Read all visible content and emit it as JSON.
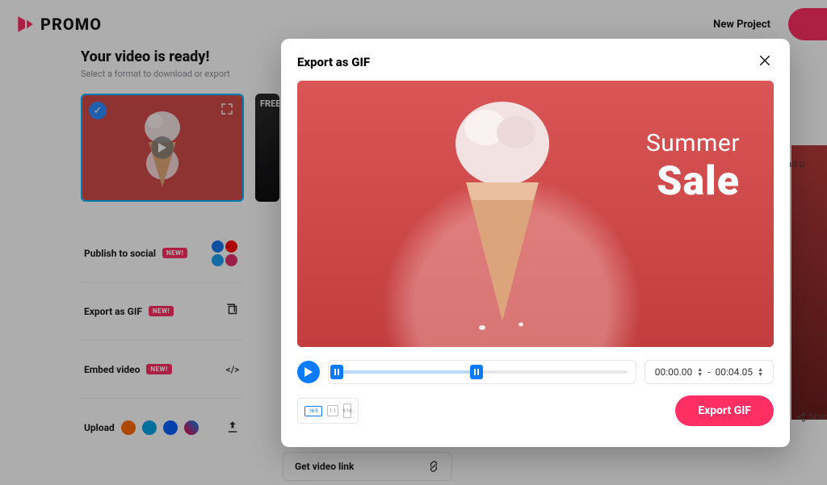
{
  "brand": "PROMO",
  "header": {
    "new_project": "New Project"
  },
  "page": {
    "title": "Your video is ready!",
    "subtitle": "Select a format to download or export",
    "free_badge": "FREE"
  },
  "options": {
    "publish": "Publish to social",
    "export_gif": "Export as GIF",
    "embed": "Embed video",
    "upload": "Upload",
    "new_badge": "NEW!",
    "embed_code": "</>",
    "get_link": "Get video link"
  },
  "right": {
    "text": "t and p",
    "share": "Shar"
  },
  "modal": {
    "title": "Export as GIF",
    "preview_line1": "Summer",
    "preview_line2": "Sale",
    "time_start": "00:00.00",
    "time_sep": "-",
    "time_end": "00:04.05",
    "ratios": {
      "r169": "16:9",
      "r11": "1:1",
      "r916": "9:16"
    },
    "export_btn": "Export GIF"
  }
}
